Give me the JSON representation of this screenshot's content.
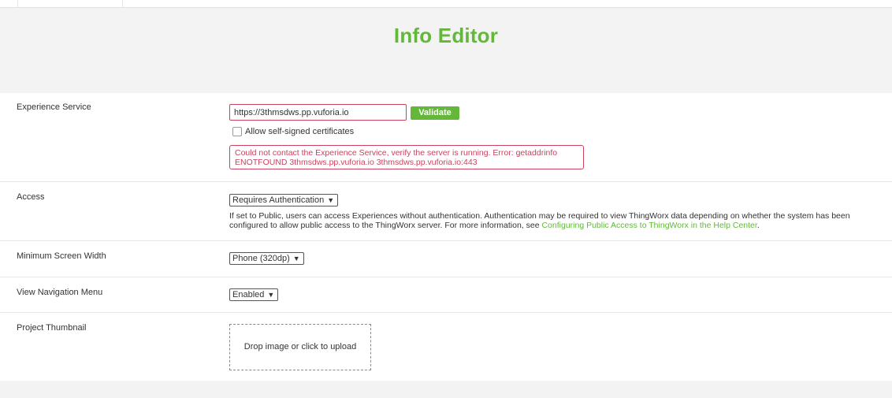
{
  "header": {
    "title": "Info Editor"
  },
  "experience_service": {
    "label": "Experience Service",
    "url_value": "https://3thmsdws.pp.vuforia.io",
    "validate_label": "Validate",
    "self_signed_label": "Allow self-signed certificates",
    "self_signed_checked": false,
    "error_line1": "Could not contact the Experience Service, verify the server is running. Error: getaddrinfo",
    "error_line2": "ENOTFOUND 3thmsdws.pp.vuforia.io 3thmsdws.pp.vuforia.io:443"
  },
  "access": {
    "label": "Access",
    "selected": "Requires Authentication",
    "help_line1": "If set to Public, users can access Experiences without authentication. Authentication may be required to view ThingWorx data depending on whether the system has been",
    "help_line2_prefix": "configured to allow public access to the ThingWorx server. For more information, see ",
    "help_link": "Configuring Public Access to ThingWorx in the Help Center",
    "help_suffix": "."
  },
  "min_screen_width": {
    "label": "Minimum Screen Width",
    "selected": "Phone (320dp)"
  },
  "view_nav_menu": {
    "label": "View Navigation Menu",
    "selected": "Enabled"
  },
  "thumbnail": {
    "label": "Project Thumbnail",
    "dropzone_text": "Drop image or click to upload"
  },
  "colors": {
    "accent": "#63b83a",
    "error": "#c8445e"
  }
}
